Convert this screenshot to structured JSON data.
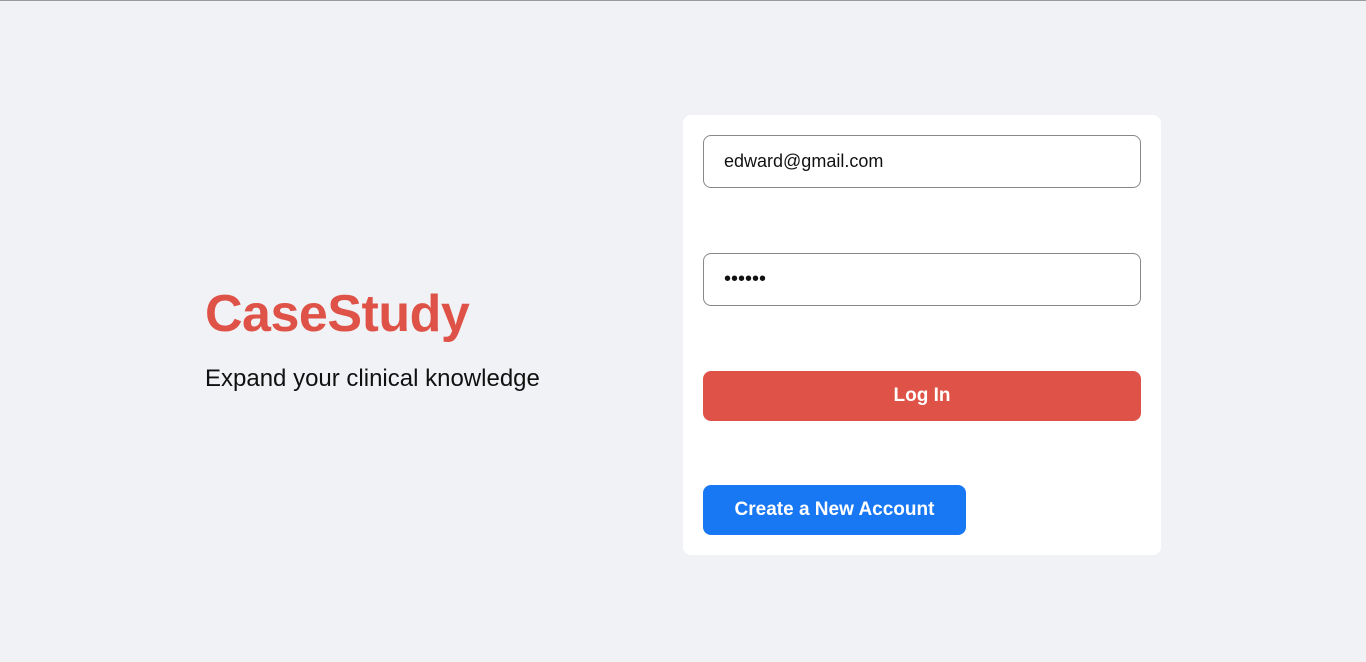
{
  "brand": {
    "name": "CaseStudy",
    "tagline": "Expand your clinical knowledge"
  },
  "login_form": {
    "email_value": "edward@gmail.com",
    "password_value": "123456",
    "login_label": "Log In",
    "create_account_label": "Create a New Account"
  },
  "colors": {
    "brand": "#df5247",
    "primary": "#1877f2",
    "background": "#f0f2f5"
  }
}
